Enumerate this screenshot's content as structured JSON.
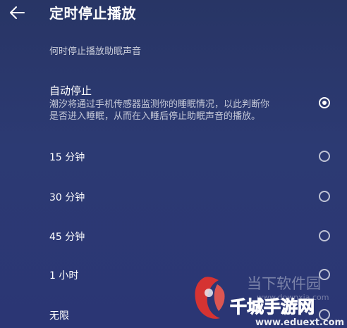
{
  "header": {
    "back_icon": "arrow-left-icon",
    "title": "定时停止播放"
  },
  "section_label": "何时停止播放助眠声音",
  "options": [
    {
      "label": "自动停止",
      "description_line1": "潮汐将通过手机传感器监测你的睡眠情况，以此判断你",
      "description_line2": "是否进入睡眠，从而在入睡后停止助眠声音的播放。",
      "selected": true
    },
    {
      "label": "15 分钟",
      "selected": false
    },
    {
      "label": "30 分钟",
      "selected": false
    },
    {
      "label": "45 分钟",
      "selected": false
    },
    {
      "label": "1 小时",
      "selected": false
    },
    {
      "label": "无限",
      "selected": false
    }
  ],
  "watermark": {
    "line1": "当下软件园",
    "line2": "www.downxia.com",
    "line3": "千城手游网",
    "line4": "www.eduext.com"
  },
  "colors": {
    "background": "#2c3a73",
    "text": "#ffffff",
    "watermark_red": "#e8332b"
  }
}
